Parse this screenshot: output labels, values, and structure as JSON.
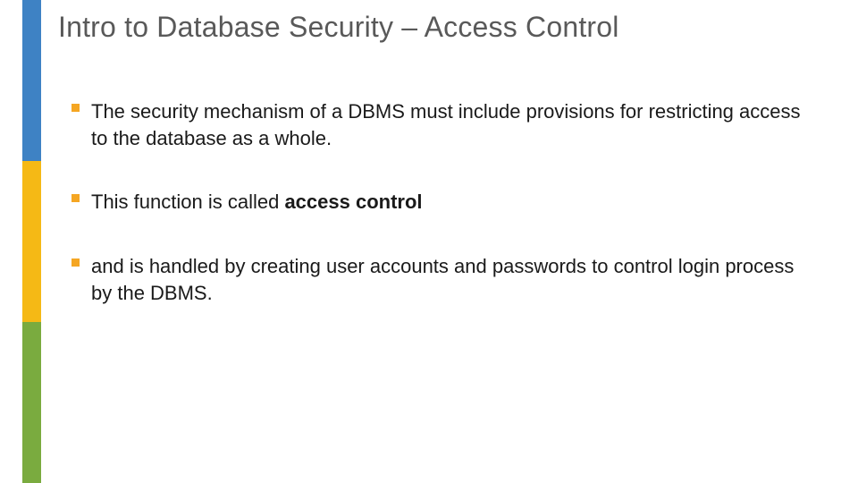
{
  "colors": {
    "sidebar_blue": "#3e82c4",
    "sidebar_yellow": "#f5b915",
    "sidebar_green": "#7aab3f",
    "bullet_square": "#f5a623",
    "title_text": "#595959"
  },
  "title": "Intro to Database Security – Access Control",
  "bullets": [
    {
      "pre": "The security mechanism of a DBMS must include provisions for restricting access to the database as a whole.",
      "bold": "",
      "post": ""
    },
    {
      "pre": "This function is called ",
      "bold": "access control",
      "post": ""
    },
    {
      "pre": "and is handled by creating user accounts and passwords to control login process by the DBMS.",
      "bold": "",
      "post": ""
    }
  ]
}
